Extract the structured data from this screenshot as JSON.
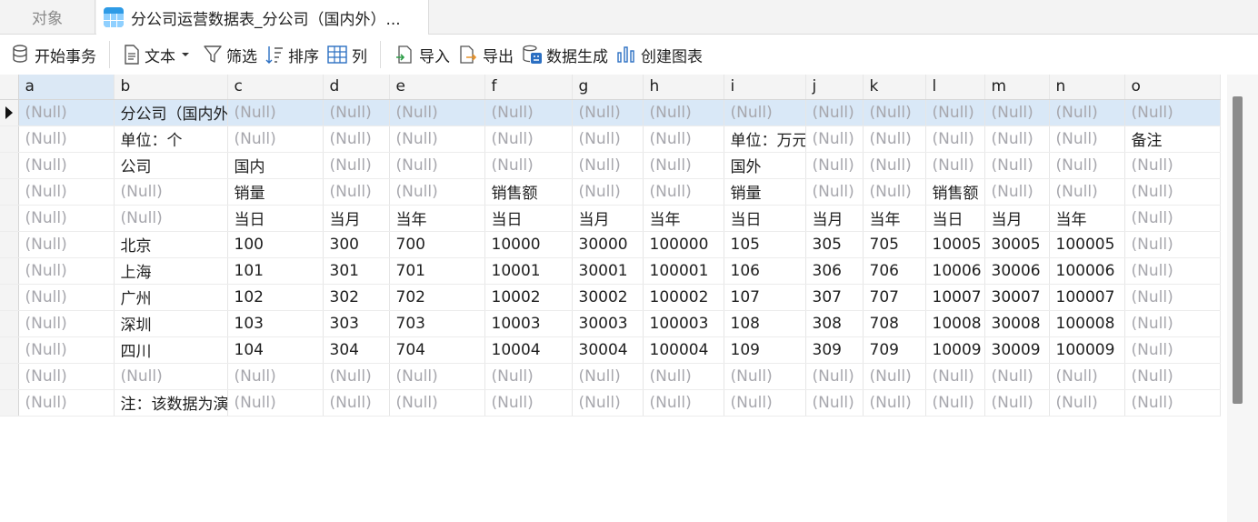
{
  "tabs": {
    "objects": "对象",
    "active": "分公司运营数据表_分公司（国内外）..."
  },
  "toolbar": {
    "begin_transaction": "开始事务",
    "text": "文本",
    "filter": "筛选",
    "sort": "排序",
    "columns": "列",
    "import": "导入",
    "export": "导出",
    "data_generation": "数据生成",
    "create_chart": "创建图表"
  },
  "grid": {
    "columns": [
      "a",
      "b",
      "c",
      "d",
      "e",
      "f",
      "g",
      "h",
      "i",
      "j",
      "k",
      "l",
      "m",
      "n",
      "o"
    ],
    "rows": [
      [
        "(Null)",
        "分公司（国内外",
        "(Null)",
        "(Null)",
        "(Null)",
        "(Null)",
        "(Null)",
        "(Null)",
        "(Null)",
        "(Null)",
        "(Null)",
        "(Null)",
        "(Null)",
        "(Null)",
        "(Null)"
      ],
      [
        "(Null)",
        "单位：个",
        "(Null)",
        "(Null)",
        "(Null)",
        "(Null)",
        "(Null)",
        "(Null)",
        "单位：万元",
        "(Null)",
        "(Null)",
        "(Null)",
        "(Null)",
        "(Null)",
        "备注"
      ],
      [
        "(Null)",
        "公司",
        "国内",
        "(Null)",
        "(Null)",
        "(Null)",
        "(Null)",
        "(Null)",
        "国外",
        "(Null)",
        "(Null)",
        "(Null)",
        "(Null)",
        "(Null)",
        "(Null)"
      ],
      [
        "(Null)",
        "(Null)",
        "销量",
        "(Null)",
        "(Null)",
        "销售额",
        "(Null)",
        "(Null)",
        "销量",
        "(Null)",
        "(Null)",
        "销售额",
        "(Null)",
        "(Null)",
        "(Null)"
      ],
      [
        "(Null)",
        "(Null)",
        "当日",
        "当月",
        "当年",
        "当日",
        "当月",
        "当年",
        "当日",
        "当月",
        "当年",
        "当日",
        "当月",
        "当年",
        "(Null)"
      ],
      [
        "(Null)",
        "北京",
        "100",
        "300",
        "700",
        "10000",
        "30000",
        "100000",
        "105",
        "305",
        "705",
        "10005",
        "30005",
        "100005",
        "(Null)"
      ],
      [
        "(Null)",
        "上海",
        "101",
        "301",
        "701",
        "10001",
        "30001",
        "100001",
        "106",
        "306",
        "706",
        "10006",
        "30006",
        "100006",
        "(Null)"
      ],
      [
        "(Null)",
        "广州",
        "102",
        "302",
        "702",
        "10002",
        "30002",
        "100002",
        "107",
        "307",
        "707",
        "10007",
        "30007",
        "100007",
        "(Null)"
      ],
      [
        "(Null)",
        "深圳",
        "103",
        "303",
        "703",
        "10003",
        "30003",
        "100003",
        "108",
        "308",
        "708",
        "10008",
        "30008",
        "100008",
        "(Null)"
      ],
      [
        "(Null)",
        "四川",
        "104",
        "304",
        "704",
        "10004",
        "30004",
        "100004",
        "109",
        "309",
        "709",
        "10009",
        "30009",
        "100009",
        "(Null)"
      ],
      [
        "(Null)",
        "(Null)",
        "(Null)",
        "(Null)",
        "(Null)",
        "(Null)",
        "(Null)",
        "(Null)",
        "(Null)",
        "(Null)",
        "(Null)",
        "(Null)",
        "(Null)",
        "(Null)",
        "(Null)"
      ],
      [
        "(Null)",
        "注：该数据为演示数据",
        "(Null)",
        "(Null)",
        "(Null)",
        "(Null)",
        "(Null)",
        "(Null)",
        "(Null)",
        "(Null)",
        "(Null)",
        "(Null)",
        "(Null)",
        "(Null)",
        "(Null)"
      ]
    ],
    "selected_row": 0,
    "selected_column": "a",
    "null_text": "(Null)",
    "null_color": "#a7a7ad",
    "selection_color": "#d9e8f7"
  }
}
